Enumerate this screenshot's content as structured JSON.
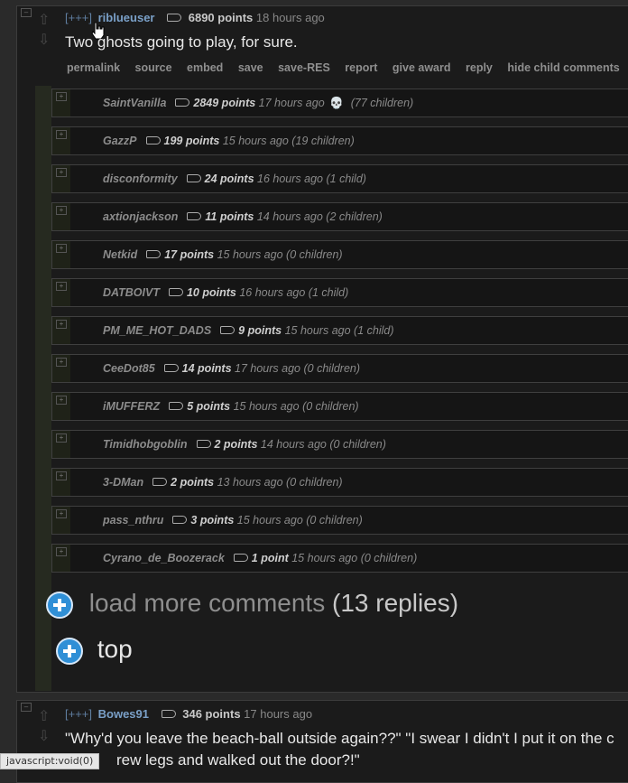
{
  "main_comment": {
    "expand": "[+++]",
    "author": "riblueuser",
    "points": "6890 points",
    "time": "18 hours ago",
    "body": "Two ghosts going to play, for sure.",
    "actions": [
      "permalink",
      "source",
      "embed",
      "save",
      "save-RES",
      "report",
      "give award",
      "reply",
      "hide child comments"
    ]
  },
  "children": [
    {
      "author": "SaintVanilla",
      "points": "2849 points",
      "time": "17 hours ago",
      "extra": "💀",
      "count": "(77 children)"
    },
    {
      "author": "GazzP",
      "points": "199 points",
      "time": "15 hours ago",
      "count": "(19 children)"
    },
    {
      "author": "disconformity",
      "points": "24 points",
      "time": "16 hours ago",
      "count": "(1 child)"
    },
    {
      "author": "axtionjackson",
      "points": "11 points",
      "time": "14 hours ago",
      "count": "(2 children)"
    },
    {
      "author": "Netkid",
      "points": "17 points",
      "time": "15 hours ago",
      "count": "(0 children)"
    },
    {
      "author": "DATBOIVT",
      "points": "10 points",
      "time": "16 hours ago",
      "count": "(1 child)"
    },
    {
      "author": "PM_ME_HOT_DADS",
      "points": "9 points",
      "time": "15 hours ago",
      "count": "(1 child)"
    },
    {
      "author": "CeeDot85",
      "points": "14 points",
      "time": "17 hours ago",
      "count": "(0 children)"
    },
    {
      "author": "iMUFFERZ",
      "points": "5 points",
      "time": "15 hours ago",
      "count": "(0 children)"
    },
    {
      "author": "Timidhobgoblin",
      "points": "2 points",
      "time": "14 hours ago",
      "count": "(0 children)"
    },
    {
      "author": "3-DMan",
      "points": "2 points",
      "time": "13 hours ago",
      "count": "(0 children)"
    },
    {
      "author": "pass_nthru",
      "points": "3 points",
      "time": "15 hours ago",
      "count": "(0 children)"
    },
    {
      "author": "Cyrano_de_Boozerack",
      "points": "1 point",
      "time": "15 hours ago",
      "count": "(0 children)"
    }
  ],
  "load_more": {
    "label": "load more comments",
    "count": "(13 replies)"
  },
  "top_label": "top",
  "second_comment": {
    "expand": "[+++]",
    "author": "Bowes91",
    "points": "346 points",
    "time": "17 hours ago",
    "body_line1": "\"Why'd you leave the beach-ball outside again??\" \"I swear I didn't I put it on the c",
    "body_line2": "rew legs and walked out the door?!\""
  },
  "status_bar": "javascript:void(0)"
}
